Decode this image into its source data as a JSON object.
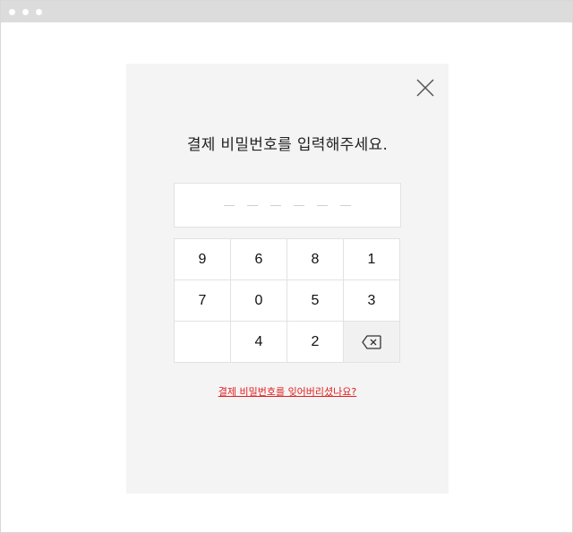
{
  "window": {
    "dot_color": "#ffffff",
    "titlebar_color": "#dcdcdc"
  },
  "modal": {
    "title": "결제 비밀번호를 입력해주세요.",
    "close_icon": "close-icon",
    "password": {
      "length": 6,
      "entered": 0
    },
    "keypad": {
      "row1": [
        "9",
        "6",
        "8",
        "1"
      ],
      "row2": [
        "7",
        "0",
        "5",
        "3"
      ],
      "row3": [
        "",
        "4",
        "2"
      ],
      "delete_icon": "backspace-icon"
    },
    "forgot_link": "결제 비밀번호를 잊어버리셨나요?",
    "colors": {
      "background": "#f4f4f4",
      "link": "#e02020"
    }
  }
}
